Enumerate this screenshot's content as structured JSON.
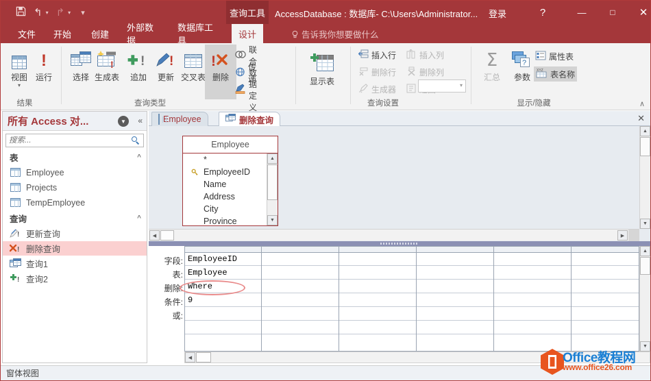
{
  "titlebar": {
    "quick_access": [
      {
        "name": "save",
        "glyph": "ὋE"
      },
      {
        "name": "undo",
        "glyph": "↶"
      },
      {
        "name": "redo",
        "glyph": "↷"
      },
      {
        "name": "customize",
        "glyph": "▾"
      }
    ],
    "context_tab": "查询工具",
    "window_title": "AccessDatabase : 数据库- C:\\Users\\Administrator...",
    "sign_in": "登录",
    "help": "?",
    "minimize": "—",
    "maximize": "□",
    "close": "✕"
  },
  "menu_tabs": [
    {
      "label": "文件",
      "active": false
    },
    {
      "label": "开始",
      "active": false
    },
    {
      "label": "创建",
      "active": false
    },
    {
      "label": "外部数据",
      "active": false
    },
    {
      "label": "数据库工具",
      "active": false
    },
    {
      "label": "设计",
      "active": true
    }
  ],
  "tell_me": "告诉我你想要做什么",
  "ribbon": {
    "groups": [
      {
        "label": "结果"
      },
      {
        "label": "查询类型"
      },
      {
        "label": "查询设置"
      },
      {
        "label": "显示/隐藏"
      }
    ],
    "results": [
      {
        "label": "视图",
        "has_caret": true
      },
      {
        "label": "运行",
        "has_caret": false
      }
    ],
    "query_types": [
      {
        "label": "选择",
        "selected": false
      },
      {
        "label": "生成表",
        "selected": false
      },
      {
        "label": "追加",
        "selected": false
      },
      {
        "label": "更新",
        "selected": false
      },
      {
        "label": "交叉表",
        "selected": false
      },
      {
        "label": "删除",
        "selected": true
      }
    ],
    "query_type_small": [
      {
        "label": "联合",
        "icon": "union-icon",
        "disabled": false
      },
      {
        "label": "传递",
        "icon": "globe-icon",
        "disabled": false
      },
      {
        "label": "数据定义",
        "icon": "data-definition-icon",
        "disabled": false
      }
    ],
    "show_table": "显示表",
    "query_setup": [
      {
        "label": "插入行",
        "disabled": false
      },
      {
        "label": "删除行",
        "disabled": true
      },
      {
        "label": "生成器",
        "disabled": true
      },
      {
        "label": "插入列",
        "disabled": true
      },
      {
        "label": "删除列",
        "disabled": true
      },
      {
        "label": "返回:",
        "disabled": true
      }
    ],
    "return_value": "",
    "show_hide": [
      {
        "label": "汇总",
        "disabled": true
      },
      {
        "label": "参数",
        "disabled": false
      },
      {
        "label": "属性表",
        "selected": false
      },
      {
        "label": "表名称",
        "selected": true
      }
    ],
    "collapse_caret": "∧"
  },
  "navpane": {
    "title": "所有 Access 对...",
    "search_placeholder": "搜索...",
    "groups": [
      {
        "label": "表",
        "items": [
          {
            "label": "Employee",
            "icon": "table-icon",
            "highlighted": false
          },
          {
            "label": "Projects",
            "icon": "table-icon",
            "highlighted": false
          },
          {
            "label": "TempEmployee",
            "icon": "table-icon",
            "highlighted": false
          }
        ]
      },
      {
        "label": "查询",
        "items": [
          {
            "label": "更新查询",
            "icon": "update-query-icon",
            "highlighted": false
          },
          {
            "label": "删除查询",
            "icon": "delete-query-icon",
            "highlighted": true
          },
          {
            "label": "查询1",
            "icon": "select-query-icon",
            "highlighted": false
          },
          {
            "label": "查询2",
            "icon": "append-query-icon",
            "highlighted": false
          }
        ]
      }
    ]
  },
  "doc_tabs": [
    {
      "label": "Employee",
      "icon": "table-icon",
      "active": false
    },
    {
      "label": "删除查询",
      "icon": "query-icon",
      "active": true
    }
  ],
  "doc_close": "✕",
  "design": {
    "table_box": {
      "title": "Employee",
      "fields": [
        "*",
        "EmployeeID",
        "Name",
        "Address",
        "City",
        "Province"
      ],
      "key_field": "EmployeeID"
    }
  },
  "query_grid": {
    "row_labels": [
      "字段:",
      "表:",
      "删除:",
      "条件:",
      "或:"
    ],
    "columns": [
      {
        "字段": "EmployeeID",
        "表": "Employee",
        "删除": "Where",
        "条件": "9",
        "或": ""
      }
    ],
    "highlight_cell": "条件"
  },
  "statusbar": {
    "text": "窗体视图"
  },
  "watermark": {
    "line1": "Office教程网",
    "line2": "www.office26.com"
  },
  "colors": {
    "accent": "#a4373a",
    "context_tab": "#8f2e31",
    "highlight_row": "#fbd0d0",
    "ellipse": "#e98b8b",
    "splitter": "#8b90b4"
  }
}
